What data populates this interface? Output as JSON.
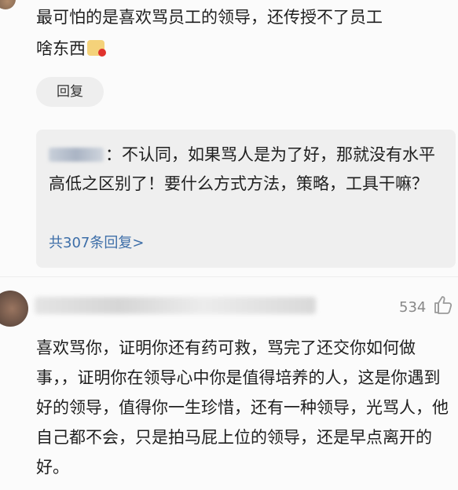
{
  "comment1": {
    "text_line1": "最可怕的是喜欢骂员工的领导，还传授不了员工",
    "text_line2": "啥东西",
    "emoji_icon": "embarrassed-face-emoji",
    "reply_button_label": "回复"
  },
  "reply_preview": {
    "text": "：不认同，如果骂人是为了好，那就没有水平高低之区别了！要什么方式方法，策略，工具干嘛？",
    "more_link": "共307条回复>"
  },
  "comment2": {
    "like_count": "534",
    "like_icon": "thumbs-up-icon",
    "text": "喜欢骂你，证明你还有药可救，骂完了还交你如何做事，，证明你在领导心中你是值得培养的人，这是你遇到好的领导，值得你一生珍惜，还有一种领导，光骂人，他自己都不会，只是拍马屁上位的领导，还是早点离开的好。"
  },
  "colors": {
    "background": "#fbfbfb",
    "reply_box": "#efefef",
    "link": "#3d6ea8",
    "muted": "#888888"
  }
}
